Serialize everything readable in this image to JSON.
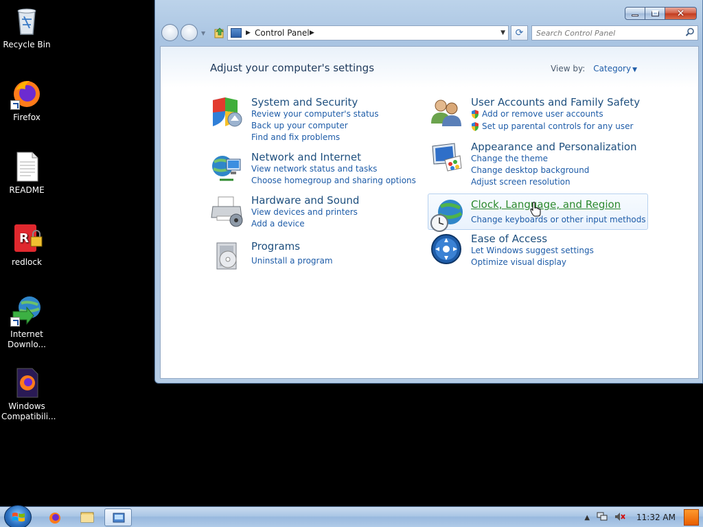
{
  "desktop": {
    "icons": [
      {
        "label": "Recycle Bin"
      },
      {
        "label": "Firefox"
      },
      {
        "label": "README"
      },
      {
        "label": "redlock"
      },
      {
        "label": "Internet Downlo..."
      },
      {
        "label": "Windows Compatibili..."
      }
    ]
  },
  "window": {
    "address": {
      "crumb": "Control Panel"
    },
    "search": {
      "placeholder": "Search Control Panel"
    },
    "heading": "Adjust your computer's settings",
    "view_by": {
      "label": "View by:",
      "value": "Category"
    },
    "categories": [
      {
        "title": "System and Security",
        "icon": "security-shield-icon",
        "links": [
          "Review your computer's status",
          "Back up your computer",
          "Find and fix problems"
        ]
      },
      {
        "title": "Network and Internet",
        "icon": "network-globe-icon",
        "links": [
          "View network status and tasks",
          "Choose homegroup and sharing options"
        ]
      },
      {
        "title": "Hardware and Sound",
        "icon": "printer-icon",
        "links": [
          "View devices and printers",
          "Add a device"
        ]
      },
      {
        "title": "Programs",
        "icon": "programs-disc-icon",
        "links": [
          "Uninstall a program"
        ]
      },
      {
        "title": "User Accounts and Family Safety",
        "icon": "users-icon",
        "links": [
          "Add or remove user accounts",
          "Set up parental controls for any user"
        ]
      },
      {
        "title": "Appearance and Personalization",
        "icon": "monitor-palette-icon",
        "links": [
          "Change the theme",
          "Change desktop background",
          "Adjust screen resolution"
        ]
      },
      {
        "title": "Clock, Language, and Region",
        "icon": "globe-clock-icon",
        "links": [
          "Change keyboards or other input methods"
        ]
      },
      {
        "title": "Ease of Access",
        "icon": "ease-of-access-icon",
        "links": [
          "Let Windows suggest settings",
          "Optimize visual display"
        ]
      }
    ]
  },
  "taskbar": {
    "clock": "11:32 AM"
  },
  "colors": {
    "link": "#1e5ca8",
    "category_title": "#1e4f7e",
    "hover_title": "#2d8a2d",
    "desktop_bg": "#000000"
  }
}
